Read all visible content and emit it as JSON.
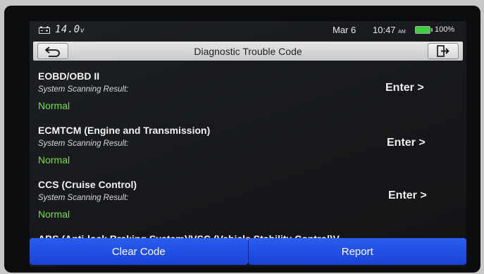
{
  "status_bar": {
    "voltage": "14.0",
    "voltage_unit": "v",
    "date": "Mar 6",
    "time": "10:47",
    "ampm": "AM",
    "battery_percent": "100%",
    "battery_level": 1.0,
    "battery_color": "#3ecf3e",
    "battery_icon": "battery-full-icon",
    "vehicle_battery_icon": "car-battery-icon"
  },
  "header": {
    "title": "Diagnostic Trouble Code",
    "back_icon": "back-arrow-icon",
    "exit_icon": "exit-icon"
  },
  "systems": [
    {
      "name": "EOBD/OBD II",
      "subtitle": "System Scanning Result:",
      "status": "Normal",
      "action": "Enter >"
    },
    {
      "name": "ECMTCM (Engine and Transmission)",
      "subtitle": "System Scanning Result:",
      "status": "Normal",
      "action": "Enter >"
    },
    {
      "name": "CCS (Cruise Control)",
      "subtitle": "System Scanning Result:",
      "status": "Normal",
      "action": "Enter >"
    },
    {
      "name": "ABS (Anti-lock Braking System)/VSC (Vehicle Stability Control)V"
    }
  ],
  "footer": {
    "clear_label": "Clear Code",
    "report_label": "Report",
    "button_color": "#2a5df0"
  },
  "colors": {
    "status_ok": "#7ddc4f",
    "screen_bg": "#1a1c1f"
  }
}
